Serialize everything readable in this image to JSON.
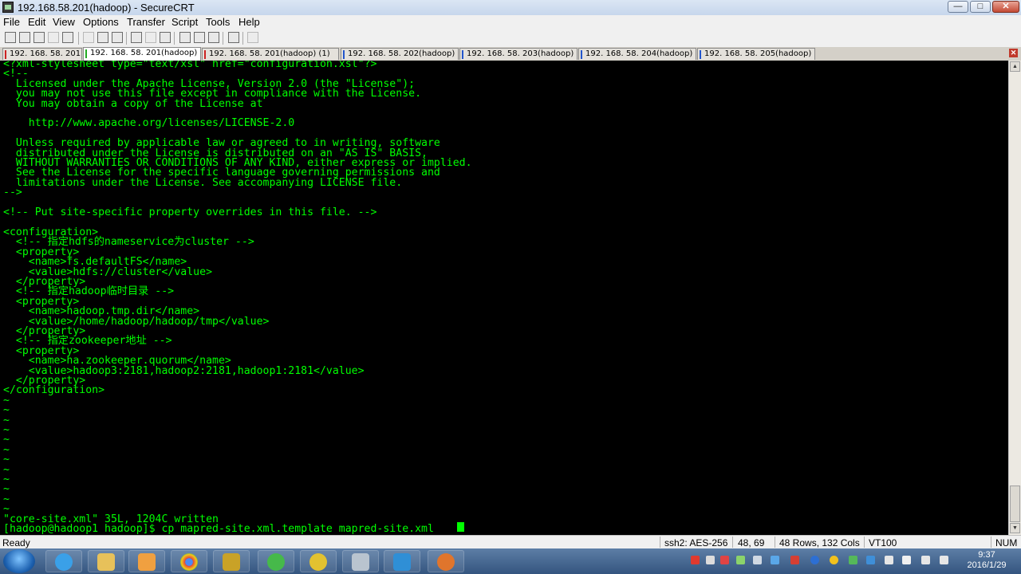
{
  "window": {
    "title": "192.168.58.201(hadoop) - SecureCRT"
  },
  "menu": [
    "File",
    "Edit",
    "View",
    "Options",
    "Transfer",
    "Script",
    "Tools",
    "Help"
  ],
  "tabs": [
    {
      "label": "192. 168. 58. 201",
      "active": false,
      "marker": "#cc2222"
    },
    {
      "label": "192. 168. 58. 201(hadoop)",
      "active": true,
      "marker": "#22aa22"
    },
    {
      "label": "192. 168. 58. 201(hadoop)  (1)",
      "active": false,
      "marker": "#cc2222"
    },
    {
      "label": "192. 168. 58. 202(hadoop)",
      "active": false,
      "marker": "#2255cc"
    },
    {
      "label": "192. 168. 58. 203(hadoop)",
      "active": false,
      "marker": "#2255cc"
    },
    {
      "label": "192. 168. 58. 204(hadoop)",
      "active": false,
      "marker": "#2255cc"
    },
    {
      "label": "192. 168. 58. 205(hadoop)",
      "active": false,
      "marker": "#2255cc"
    }
  ],
  "terminal": {
    "lines": [
      "<?xml-stylesheet type=\"text/xsl\" href=\"configuration.xsl\"?>",
      "<!--",
      "  Licensed under the Apache License, Version 2.0 (the \"License\");",
      "  you may not use this file except in compliance with the License.",
      "  You may obtain a copy of the License at",
      "",
      "    http://www.apache.org/licenses/LICENSE-2.0",
      "",
      "  Unless required by applicable law or agreed to in writing, software",
      "  distributed under the License is distributed on an \"AS IS\" BASIS,",
      "  WITHOUT WARRANTIES OR CONDITIONS OF ANY KIND, either express or implied.",
      "  See the License for the specific language governing permissions and",
      "  limitations under the License. See accompanying LICENSE file.",
      "-->",
      "",
      "<!-- Put site-specific property overrides in this file. -->",
      "",
      "<configuration>",
      "  <!-- 指定hdfs的nameservice为cluster -->",
      "  <property>",
      "    <name>fs.defaultFS</name>",
      "    <value>hdfs://cluster</value>",
      "  </property>",
      "  <!-- 指定hadoop临时目录 -->",
      "  <property>",
      "    <name>hadoop.tmp.dir</name>",
      "    <value>/home/hadoop/hadoop/tmp</value>",
      "  </property>",
      "  <!-- 指定zookeeper地址 -->",
      "  <property>",
      "    <name>ha.zookeeper.quorum</name>",
      "    <value>hadoop3:2181,hadoop2:2181,hadoop1:2181</value>",
      "  </property>",
      "</configuration>",
      "~",
      "~",
      "~",
      "~",
      "~",
      "~",
      "~",
      "~",
      "~",
      "~",
      "~",
      "~",
      "\"core-site.xml\" 35L, 1204C written",
      "[hadoop@hadoop1 hadoop]$ cp mapred-site.xml.template mapred-site.xml"
    ]
  },
  "status": {
    "ready": "Ready",
    "cipher": "ssh2: AES-256",
    "position": "48,  69",
    "size": "48 Rows, 132 Cols",
    "emulation": "VT100",
    "num": "NUM"
  },
  "clock": {
    "time": "9:37",
    "date": "2016/1/29"
  }
}
